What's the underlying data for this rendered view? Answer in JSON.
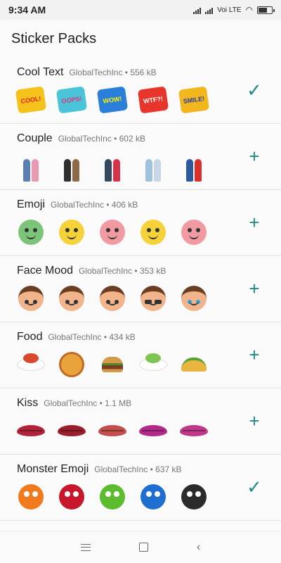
{
  "status": {
    "time": "9:34 AM",
    "network": "Voi LTE"
  },
  "app": {
    "title": "Sticker Packs"
  },
  "packs": [
    {
      "name": "Cool Text",
      "meta": "GlobalTechInc • 556 kB",
      "action": "✓",
      "stickers": [
        "COOL!",
        "OOPS!",
        "WOW!",
        "WTF?!",
        "SMILE!"
      ]
    },
    {
      "name": "Couple",
      "meta": "GlobalTechInc • 602 kB",
      "action": "+"
    },
    {
      "name": "Emoji",
      "meta": "GlobalTechInc • 406 kB",
      "action": "+"
    },
    {
      "name": "Face Mood",
      "meta": "GlobalTechInc • 353 kB",
      "action": "+"
    },
    {
      "name": "Food",
      "meta": "GlobalTechInc • 434 kB",
      "action": "+"
    },
    {
      "name": "Kiss",
      "meta": "GlobalTechInc • 1.1 MB",
      "action": "+"
    },
    {
      "name": "Monster Emoji",
      "meta": "GlobalTechInc • 637 kB",
      "action": "✓"
    }
  ],
  "colors": {
    "accent": "#1e8c82"
  }
}
